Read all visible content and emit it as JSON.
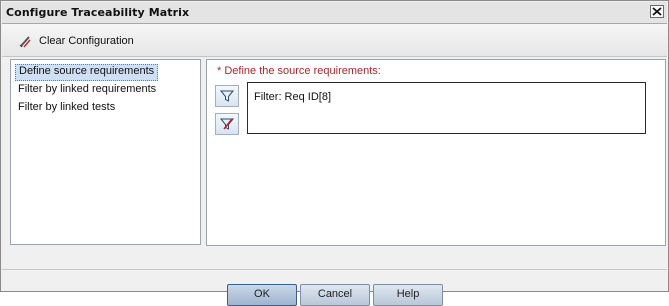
{
  "window": {
    "title": "Configure Traceability Matrix",
    "close_icon": "close-icon"
  },
  "toolbar": {
    "clear_label": "Clear Configuration",
    "clear_icon": "eraser-icon"
  },
  "nav": {
    "items": [
      {
        "label": "Define source requirements",
        "selected": true
      },
      {
        "label": "Filter by linked requirements",
        "selected": false
      },
      {
        "label": "Filter by linked tests",
        "selected": false
      }
    ]
  },
  "main": {
    "section_label": "* Define the source requirements:",
    "filter_text": "Filter: Req ID[8]",
    "set_filter_icon": "filter-icon",
    "clear_filter_icon": "clear-filter-icon"
  },
  "footer": {
    "ok_label": "OK",
    "cancel_label": "Cancel",
    "help_label": "Help"
  },
  "colors": {
    "required_label": "#a52a2a",
    "selection": "#cfe0f4"
  }
}
